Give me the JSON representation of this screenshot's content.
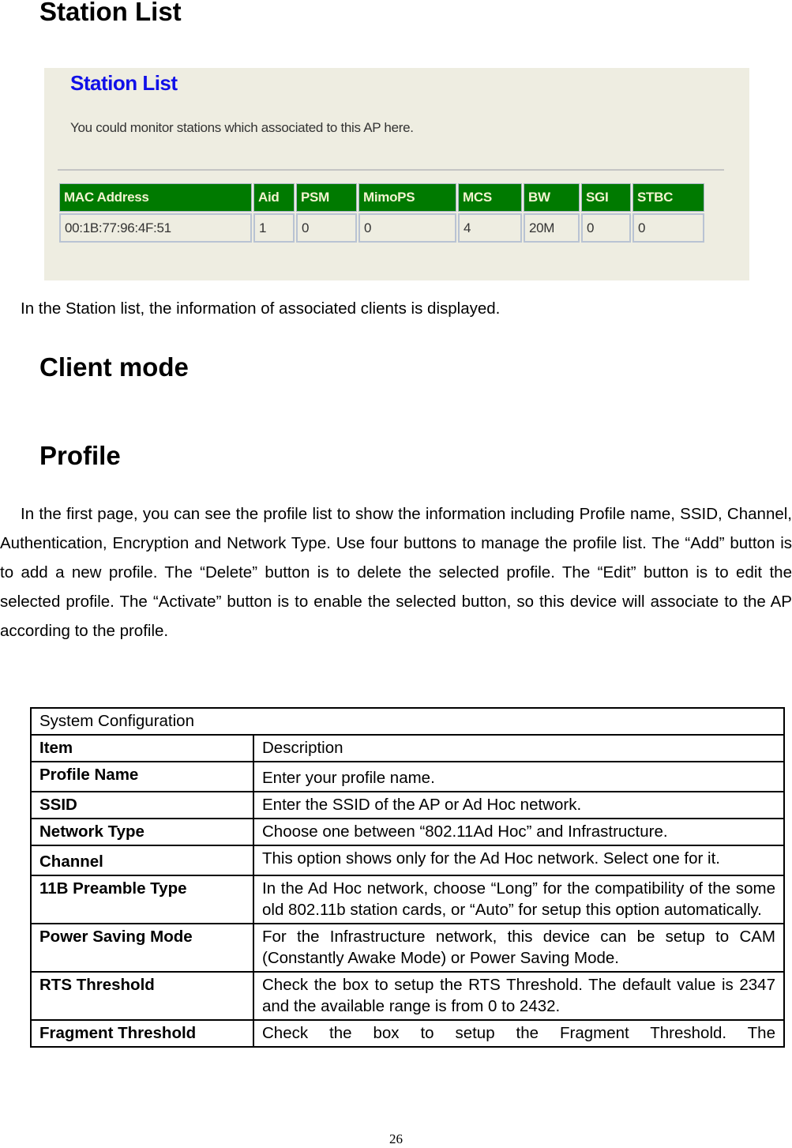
{
  "headings": {
    "station_list": "Station List",
    "client_mode": "Client mode",
    "profile": "Profile"
  },
  "station_screenshot": {
    "title": "Station List",
    "description": "You could monitor stations which associated to this AP here.",
    "colors": {
      "header_bg": "#007a00",
      "header_text": "#f3f3d0",
      "title": "#1010e8",
      "panel_bg": "#eeede1"
    },
    "columns": [
      "MAC Address",
      "Aid",
      "PSM",
      "MimoPS",
      "MCS",
      "BW",
      "SGI",
      "STBC"
    ],
    "rows": [
      [
        "00:1B:77:96:4F:51",
        "1",
        "0",
        "0",
        "4",
        "20M",
        "0",
        "0"
      ]
    ]
  },
  "paragraphs": {
    "station": "In the Station list, the information of associated clients is displayed.",
    "profile": "In the first page, you can see the profile list to show the information including Profile name, SSID, Channel, Authentication, Encryption and Network Type. Use four buttons to manage the profile list. The “Add” button is to add a new profile. The “Delete” button is to delete the selected profile. The “Edit” button is to edit the selected profile. The “Activate” button is to enable the selected button, so this device will associate to the AP according to the profile."
  },
  "config_table": {
    "title": "System Configuration",
    "header": {
      "item": "Item",
      "description": "Description"
    },
    "rows": [
      {
        "item": "Profile Name",
        "description": "Enter your profile name."
      },
      {
        "item": "SSID",
        "description": "Enter the SSID of the AP or Ad Hoc network."
      },
      {
        "item": "Network Type",
        "description": "Choose one between “802.11Ad Hoc” and Infrastructure."
      },
      {
        "item": "Channel",
        "description": "This option shows only for the Ad Hoc network. Select one for it."
      },
      {
        "item": "11B Preamble Type",
        "description": "In the Ad Hoc network, choose “Long” for the compatibility of the some old 802.11b station cards, or “Auto” for setup this option automatically."
      },
      {
        "item": "Power Saving Mode",
        "description": "For the Infrastructure network, this device can be setup to CAM (Constantly Awake Mode) or Power Saving Mode."
      },
      {
        "item": "RTS Threshold",
        "description": "Check the box to setup the RTS Threshold. The default value is 2347 and the available range is from 0 to 2432."
      },
      {
        "item": "Fragment Threshold",
        "description": "Check the box to setup the Fragment Threshold. The"
      }
    ]
  },
  "page_number": "26"
}
